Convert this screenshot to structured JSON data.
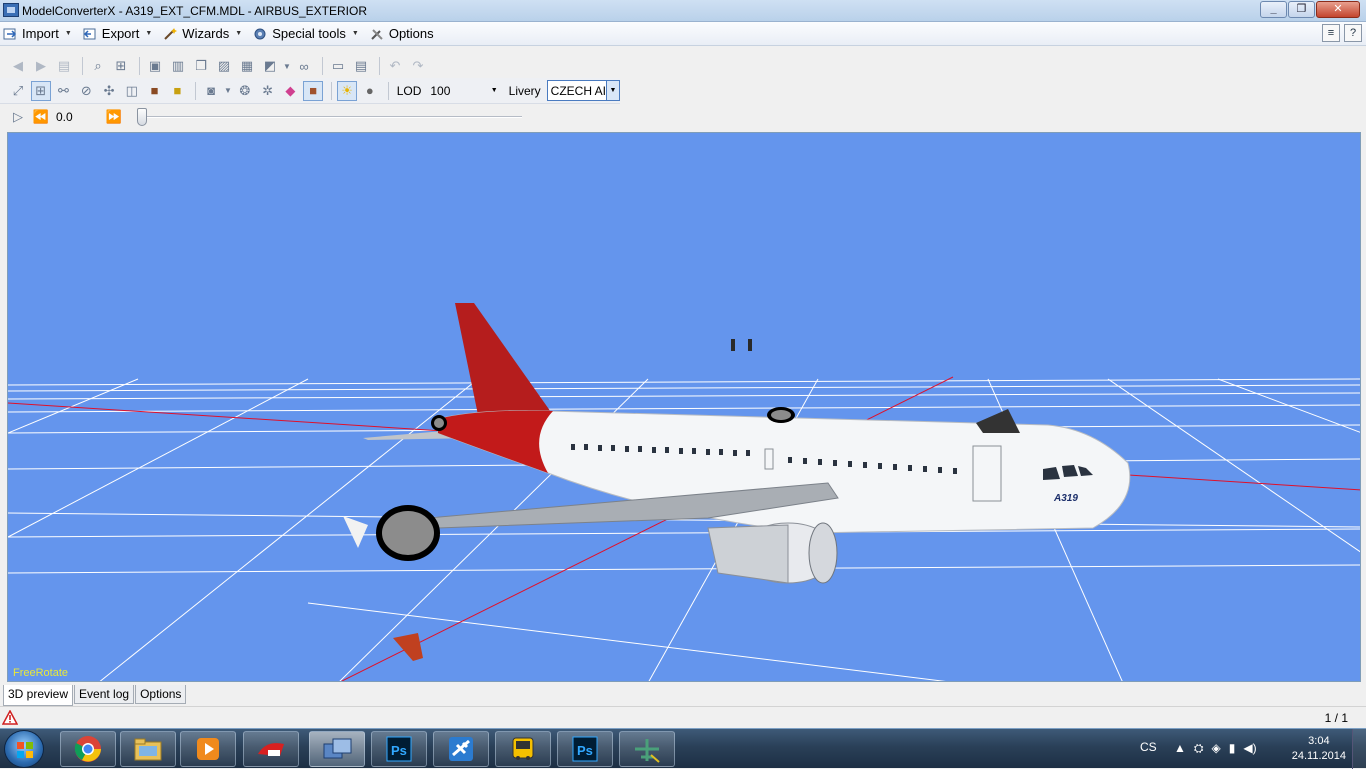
{
  "window": {
    "app_name": "ModelConverterX",
    "title": "ModelConverterX - A319_EXT_CFM.MDL - AIRBUS_EXTERIOR",
    "minimize_glyph": "_",
    "maximize_glyph": "❐",
    "close_glyph": "✕"
  },
  "menu": {
    "import": "Import",
    "export": "Export",
    "wizards": "Wizards",
    "special_tools": "Special tools",
    "options": "Options"
  },
  "toolbar2": {
    "lod_label": "LOD",
    "lod_value": "100",
    "livery_label": "Livery",
    "livery_value": "CZECH AI"
  },
  "animation": {
    "time_value": "0.0",
    "slider_position": 0
  },
  "viewport": {
    "mode_label": "FreeRotate",
    "background_color": "#6495ed",
    "model_text": "A319"
  },
  "tabs": {
    "preview": "3D preview",
    "event_log": "Event log",
    "options": "Options",
    "active": "3D preview"
  },
  "status": {
    "pages": "1 / 1"
  },
  "taskbar": {
    "language": "CS",
    "time": "3:04",
    "date": "24.11.2014",
    "apps": [
      "chrome",
      "explorer",
      "media-player",
      "paint-app",
      "modelconverterx",
      "photoshop",
      "flight-sim",
      "bus-app",
      "photoshop",
      "aircraft-app"
    ]
  }
}
